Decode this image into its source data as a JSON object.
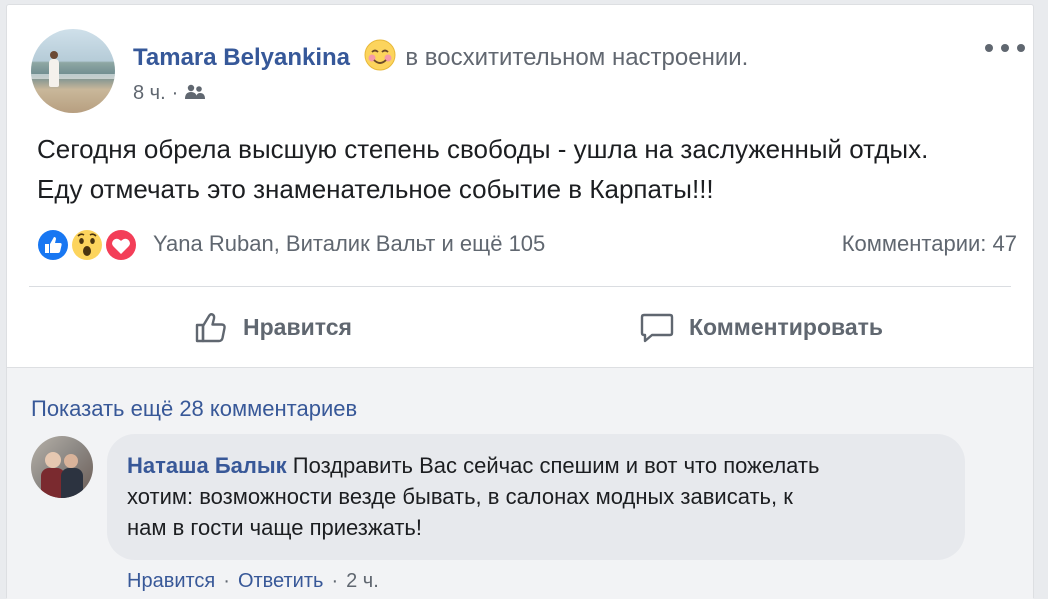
{
  "post": {
    "author": "Tamara Belyankina",
    "feeling": "в восхитительном настроении.",
    "feeling_icon": "blushing-face-icon",
    "time": "8 ч.",
    "meta_separator": "·",
    "audience_icon": "friends-icon",
    "text_lines": [
      "Сегодня обрела высшую степень свободы - ушла на заслуженный отдых.",
      "Еду отмечать это знаменательное событие в Карпаты!!!"
    ]
  },
  "reactions": {
    "icons": [
      "like-reaction-icon",
      "wow-reaction-icon",
      "love-reaction-icon"
    ],
    "names": "Yana Ruban, Виталик Вальт и ещё 105",
    "comments": "Комментарии: 47"
  },
  "actions": {
    "like": "Нравится",
    "comment": "Комментировать"
  },
  "comments": {
    "show_more": "Показать ещё 28 комментариев",
    "items": [
      {
        "author": "Наташа Балык",
        "lines": [
          "Поздравить Вас сейчас спешим и вот что пожелать",
          "хотим: возможности везде бывать, в салонах модных зависать, к",
          "нам в гости чаще приезжать!"
        ],
        "like": "Нравится",
        "reply": "Ответить",
        "time": "2 ч.",
        "separator": "·"
      }
    ]
  },
  "colors": {
    "link": "#385898",
    "author": "#365899",
    "secondary_text": "#606770",
    "like_blue": "#1877f2",
    "love_red": "#f33e58",
    "wow_yellow": "#fcd45d"
  }
}
